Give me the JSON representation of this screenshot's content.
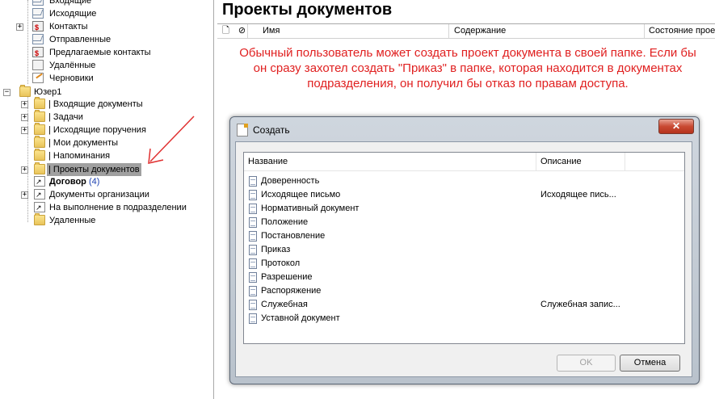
{
  "tree": {
    "items": [
      {
        "label": "Входящие",
        "icon": "mail-icon"
      },
      {
        "label": "Исходящие",
        "icon": "mail-icon"
      },
      {
        "label": "Контакты",
        "icon": "contacts-icon"
      },
      {
        "label": "Отправленные",
        "icon": "folder-icon"
      },
      {
        "label": "Предлагаемые контакты",
        "icon": "contacts-icon"
      },
      {
        "label": "Удалённые",
        "icon": "deleted-icon"
      },
      {
        "label": "Черновики",
        "icon": "drafts-icon"
      },
      {
        "label": "Юзер1",
        "icon": "folder-icon"
      },
      {
        "label": "| Входящие документы",
        "icon": "folder-icon"
      },
      {
        "label": "| Задачи",
        "icon": "folder-icon"
      },
      {
        "label": "| Исходящие поручения",
        "icon": "folder-icon"
      },
      {
        "label": "| Мои документы",
        "icon": "folder-icon"
      },
      {
        "label": "| Напоминания",
        "icon": "folder-icon"
      },
      {
        "label": "| Проекты документов",
        "icon": "folder-icon"
      },
      {
        "label": "Договор",
        "count": "(4)",
        "icon": "folder-icon"
      },
      {
        "label": "Документы организации",
        "icon": "org-folder-icon"
      },
      {
        "label": "На выполнение в подразделении",
        "icon": "org-folder-icon"
      },
      {
        "label": "Удаленные",
        "icon": "folder-icon"
      }
    ]
  },
  "main": {
    "title": "Проекты документов",
    "columns": [
      "Имя",
      "Содержание",
      "Состояние прое"
    ],
    "note": "Обычный пользователь может создать проект документа в своей папке. Если бы он сразу захотел создать \"Приказ\" в папке, которая находится в документах подразделения, он получил бы отказ по правам доступа."
  },
  "dialog": {
    "title": "Создать",
    "close_label": "✕",
    "columns": [
      "Название",
      "Описание"
    ],
    "rows": [
      {
        "name": "Доверенность",
        "desc": ""
      },
      {
        "name": "Исходящее письмо",
        "desc": "Исходящее пись..."
      },
      {
        "name": "Нормативный документ",
        "desc": ""
      },
      {
        "name": "Положение",
        "desc": ""
      },
      {
        "name": "Постановление",
        "desc": ""
      },
      {
        "name": "Приказ",
        "desc": ""
      },
      {
        "name": "Протокол",
        "desc": ""
      },
      {
        "name": "Разрешение",
        "desc": ""
      },
      {
        "name": "Распоряжение",
        "desc": ""
      },
      {
        "name": "Служебная",
        "desc": "Служебная запис..."
      },
      {
        "name": "Уставной документ",
        "desc": ""
      }
    ],
    "ok_label": "OK",
    "cancel_label": "Отмена"
  },
  "colors": {
    "note": "#e02020",
    "arrow": "#e03030",
    "selection": "#a0a0a0"
  }
}
